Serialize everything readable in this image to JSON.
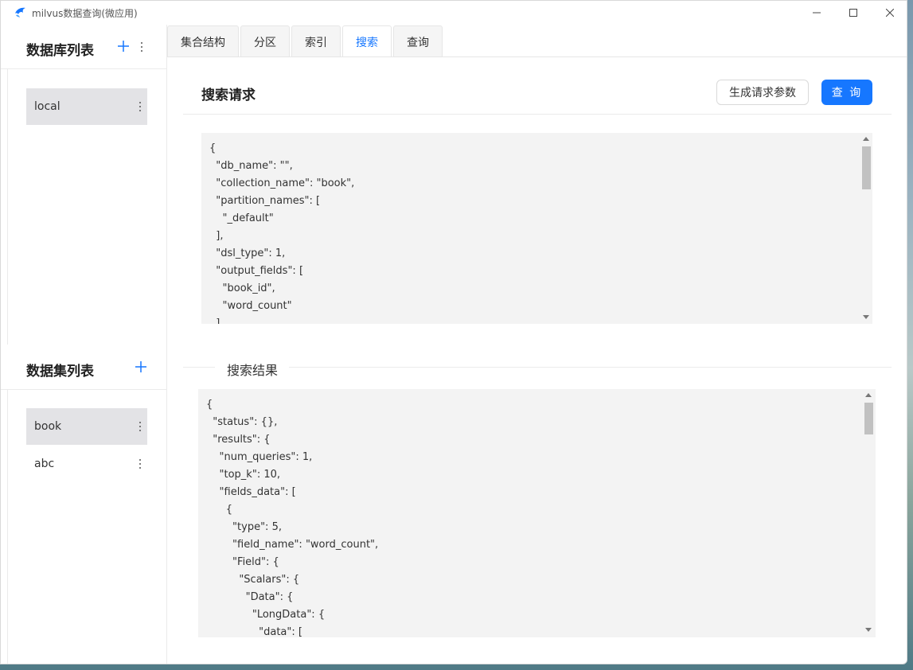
{
  "window": {
    "title": "milvus数据查询(微应用)",
    "controls": {
      "minimize": "minimize-icon",
      "maximize": "maximize-icon",
      "close": "close-icon"
    }
  },
  "databases": {
    "title": "数据库列表",
    "items": [
      {
        "label": "local",
        "selected": true
      }
    ]
  },
  "collections": {
    "title": "数据集列表",
    "items": [
      {
        "label": "book",
        "selected": true
      },
      {
        "label": "abc",
        "selected": false
      }
    ]
  },
  "tabs": [
    {
      "label": "集合结构",
      "active": false
    },
    {
      "label": "分区",
      "active": false
    },
    {
      "label": "索引",
      "active": false
    },
    {
      "label": "搜索",
      "active": true
    },
    {
      "label": "查询",
      "active": false
    }
  ],
  "search_request": {
    "title": "搜索请求",
    "generate_button": "生成请求参数",
    "query_button": "查 询",
    "code_lines": [
      "{",
      "  \"db_name\": \"\",",
      "  \"collection_name\": \"book\",",
      "  \"partition_names\": [",
      "    \"_default\"",
      "  ],",
      "  \"dsl_type\": 1,",
      "  \"output_fields\": [",
      "    \"book_id\",",
      "    \"word_count\"",
      "  ],"
    ]
  },
  "search_result": {
    "title": "搜索结果",
    "code_lines": [
      "{",
      "  \"status\": {},",
      "  \"results\": {",
      "    \"num_queries\": 1,",
      "    \"top_k\": 10,",
      "    \"fields_data\": [",
      "      {",
      "        \"type\": 5,",
      "        \"field_name\": \"word_count\",",
      "        \"Field\": {",
      "          \"Scalars\": {",
      "            \"Data\": {",
      "              \"LongData\": {",
      "                \"data\": ["
    ]
  },
  "colors": {
    "accent": "#1677ff",
    "selected_bg": "#e3e3e6",
    "code_bg": "#f3f3f3"
  }
}
